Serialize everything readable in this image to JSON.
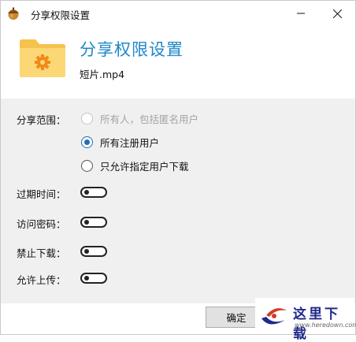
{
  "window": {
    "title": "分享权限设置",
    "icon": "acorn-icon",
    "minimize_icon": "minimize-icon",
    "close_icon": "close-icon"
  },
  "header": {
    "title": "分享权限设置",
    "file_name": "短片.mp4",
    "icon": "folder-gear-icon",
    "accent": "#1e87c8"
  },
  "share_scope": {
    "label": "分享范围：",
    "options": [
      {
        "label": "所有人，包括匿名用户",
        "state": "disabled"
      },
      {
        "label": "所有注册用户",
        "state": "checked"
      },
      {
        "label": "只允许指定用户下载",
        "state": "unchecked"
      }
    ]
  },
  "toggles": [
    {
      "label": "过期时间：",
      "on": false
    },
    {
      "label": "访问密码：",
      "on": false
    },
    {
      "label": "禁止下载：",
      "on": false
    },
    {
      "label": "允许上传：",
      "on": false
    }
  ],
  "footer": {
    "confirm_label": "确定"
  },
  "watermark": {
    "text": "这里下载",
    "url": "www.heredown.com"
  }
}
